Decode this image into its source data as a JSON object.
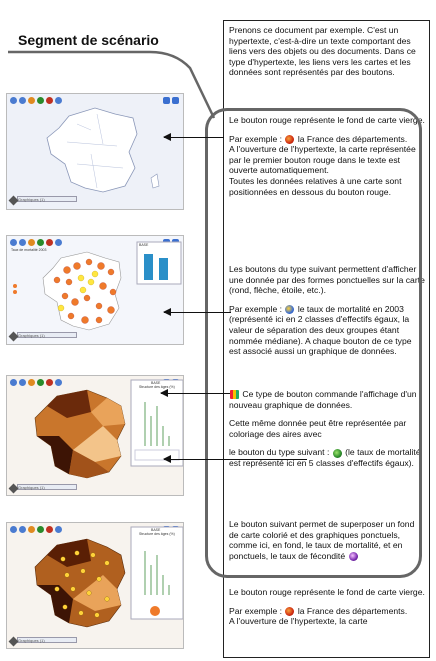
{
  "heading": "Segment de scénario",
  "paragraphs": {
    "intro": "Prenons ce document par exemple. C'est un hypertexte, c'est-à-dire un texte comportant des liens vers des objets ou des documents. Dans ce type d'hypertexte, les liens vers les cartes et les données sont représentés par des boutons.",
    "fond1": "Le bouton rouge représente le fond de carte vierge.",
    "ex1_pre": "Par exemple :",
    "ex1_post": "la France des départements.",
    "ex1_open": "A l'ouverture de l'hypertexte, la carte représentée par le premier bouton rouge dans le texte est ouverte automatiquement.",
    "ex1_data": "Toutes les données relatives à une carte sont positionnées en dessous du bouton rouge.",
    "ponct": "Les boutons du type suivant permettent d'afficher une donnée par des formes ponctuelles sur la carte (rond, flèche, étoile, etc.).",
    "ex2_pre": "Par exemple :",
    "ex2_post": "le taux de mortalité en 2003 (représenté ici en 2 classes d'effectifs égaux, la valeur de séparation des deux groupes étant nommée médiane). A chaque bouton de ce type est associé aussi un graphique de données.",
    "graph": "Ce type de bouton commande l'affichage d'un nouveau graphique de données.",
    "aire_1": "Cette même donnée peut être représentée par coloriage des aires avec",
    "aire_2a": "le bouton du type suivant :",
    "aire_2b": "(le taux de mortalité est représenté ici en 5 classes d'effectifs égaux).",
    "superp_1": "Le bouton suivant permet de superposer un fond de carte colorié et des graphiques ponctuels, comme ici, en fond, le taux de mortalité, et en ponctuels, le taux de fécondité",
    "fond2": "Le bouton rouge représente le fond de carte vierge.",
    "ex3_pre": "Par exemple :",
    "ex3_post": "la France des départements.",
    "ex3_open": "A l'ouverture de l'hypertexte, la carte"
  },
  "maps": {
    "m2_title": "Taux de mortalité 2003",
    "m2_chart_title": "BASE",
    "m3_title": "BASE",
    "m3_sub": "Structure des âges (%)",
    "m4_title": "BASE",
    "m4_sub": "Structure des âges (%)",
    "combo_label": "Graphiques (1)"
  },
  "colors": {
    "accent_border": "#666666",
    "red_button": "#d02a12",
    "blue_button": "#3b6fd6",
    "green_button": "#2a8a2a"
  }
}
